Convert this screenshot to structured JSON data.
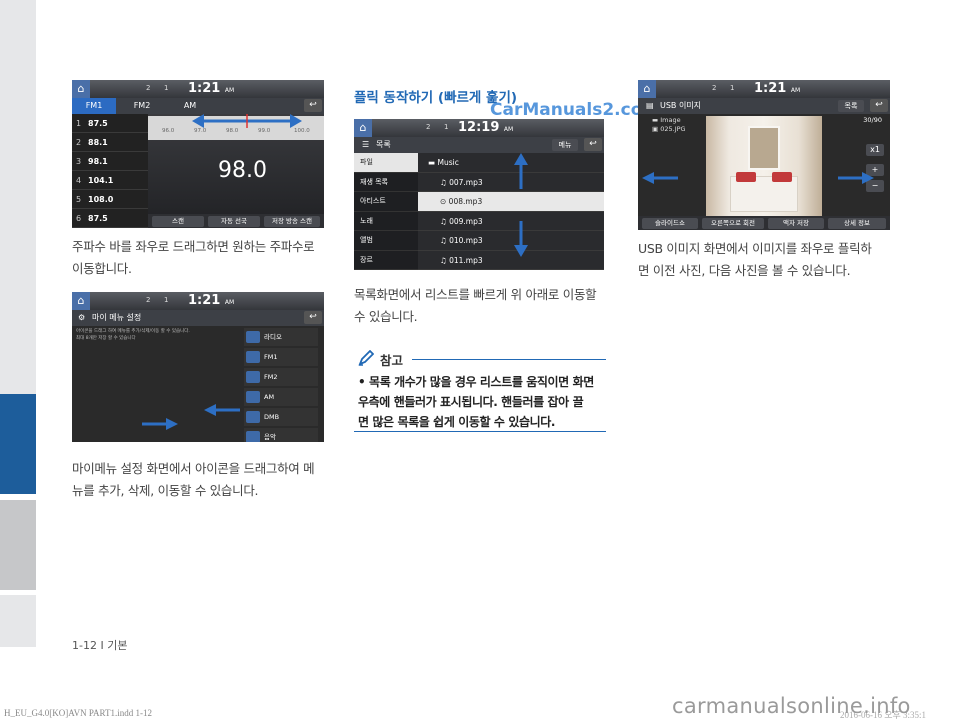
{
  "shot1": {
    "indicator": "2",
    "indicator2": "1",
    "clock": "1:21",
    "ampm": "AM",
    "tabs": [
      "FM1",
      "FM2",
      "AM"
    ],
    "presets": [
      {
        "num": "1",
        "freq": "87.5"
      },
      {
        "num": "2",
        "freq": "88.1"
      },
      {
        "num": "3",
        "freq": "98.1"
      },
      {
        "num": "4",
        "freq": "104.1"
      },
      {
        "num": "5",
        "freq": "108.0"
      },
      {
        "num": "6",
        "freq": "87.5"
      }
    ],
    "scale": [
      "96.0",
      "97.0",
      "98.0",
      "99.0",
      "100.0"
    ],
    "frequency": "98.0",
    "buttons": [
      "스캔",
      "자동 선국",
      "저장 방송 스캔"
    ]
  },
  "caption1": [
    "주파수 바를 좌우로 드래그하면 원하는 주파수로",
    "이동합니다."
  ],
  "shot2": {
    "indicator": "2",
    "indicator2": "1",
    "clock": "1:21",
    "ampm": "AM",
    "title": "마이 메뉴 설정",
    "desc1": "아이콘을 드래그 하여 메뉴를 추가/삭제/이동 할 수 있습니다.",
    "desc2": "최대 8개만 저장 할 수 있습니다",
    "items": [
      "라디오",
      "FM1",
      "FM2",
      "AM",
      "DMB",
      "음악"
    ]
  },
  "caption2": [
    "마이메뉴 설정 화면에서 아이콘을 드래그하여 메",
    "뉴를 추가, 삭제, 이동할 수 있습니다."
  ],
  "heading": "플릭 동작하기 (빠르게 훑기)",
  "watermark": "CarManuals2.com",
  "shot3": {
    "indicator": "2",
    "indicator2": "1",
    "clock": "12:19",
    "ampm": "AM",
    "title": "목록",
    "menu": "메뉴",
    "categories": [
      "파일",
      "재생 목록",
      "아티스트",
      "노래",
      "앨범",
      "장르"
    ],
    "folder": "Music",
    "songs": [
      "007.mp3",
      "008.mp3",
      "009.mp3",
      "010.mp3",
      "011.mp3"
    ]
  },
  "caption3": [
    "목록화면에서 리스트를 빠르게 위 아래로 이동할",
    "수 있습니다."
  ],
  "note": {
    "title": "참고",
    "text": [
      "• 목록 개수가 많을 경우 리스트를 움직이면 화면",
      "우측에 핸들러가 표시됩니다. 핸들러를 잡아 끌",
      "면 많은 목록을 쉽게 이동할 수 있습니다."
    ]
  },
  "shot4": {
    "indicator": "2",
    "indicator2": "1",
    "clock": "1:21",
    "ampm": "AM",
    "title": "USB 이미지",
    "list_btn": "목록",
    "folder": "Image",
    "file": "025.JPG",
    "count": "30/90",
    "zoom": "x1",
    "plus": "+",
    "minus": "−",
    "buttons": [
      "슬라이드쇼",
      "오른쪽으로 회전",
      "액자 저장",
      "상세 정보"
    ]
  },
  "caption4": [
    "USB 이미지 화면에서 이미지를 좌우로 플릭하",
    "면 이전 사진, 다음 사진을 볼 수 있습니다."
  ],
  "footer": "1-12 I 기본",
  "imprint": "H_EU_G4.0[KO]AVN PART1.indd   1-12",
  "imprint_right": "2016-06-16  오후 3:35:1",
  "site": "carmanualsonline.info",
  "colors": {
    "accent": "#2169b5",
    "sidebar_active": "#1d5d9b",
    "arrow": "#2d6fc4"
  }
}
